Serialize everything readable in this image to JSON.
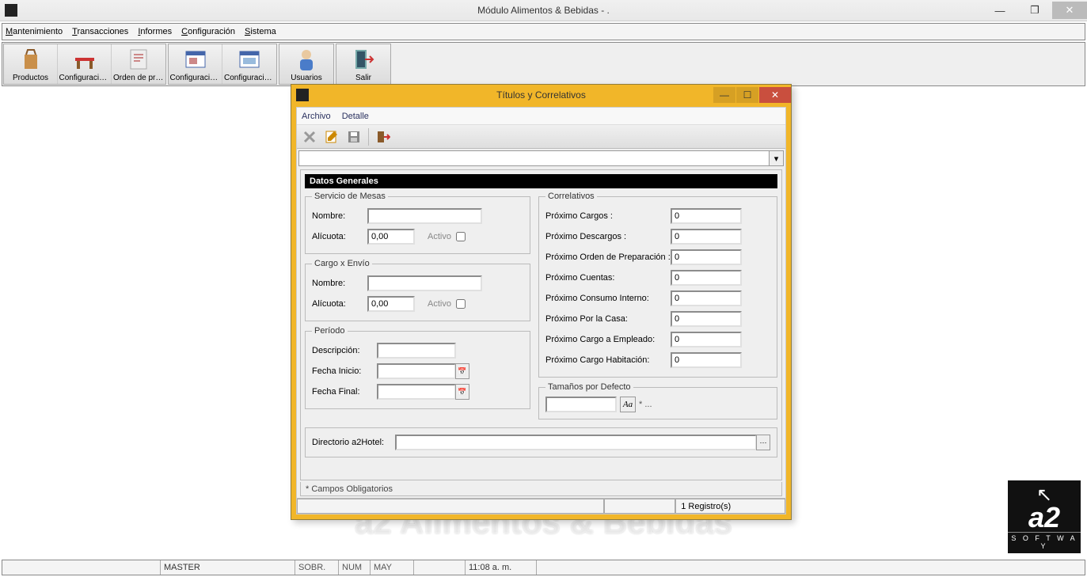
{
  "main": {
    "title": "Módulo Alimentos & Bebidas - .",
    "menu": [
      "Mantenimiento",
      "Transacciones",
      "Informes",
      "Configuración",
      "Sistema"
    ],
    "toolbar": [
      {
        "label": "Productos"
      },
      {
        "label": "Configuración d..."
      },
      {
        "label": "Orden de prepar..."
      },
      {
        "label": "Configuración d..."
      },
      {
        "label": "Configuración d..."
      },
      {
        "label": "Usuarios"
      },
      {
        "label": "Salir"
      }
    ],
    "watermark": "a2 Alimentos & Bebidas",
    "logo": {
      "cursor": "↖",
      "brand": "a2",
      "sub": "S O F T W A Y"
    }
  },
  "statusbar": {
    "user": "MASTER",
    "sobr": "SOBR.",
    "num": "NUM",
    "may": "MAY",
    "time": "11:08 a. m."
  },
  "modal": {
    "title": "Títulos y Correlativos",
    "menu": [
      "Archivo",
      "Detalle"
    ],
    "section_header": "Datos Generales",
    "mesas": {
      "legend": "Servicio de Mesas",
      "nombre_lbl": "Nombre:",
      "nombre_val": "",
      "alicuota_lbl": "Alícuota:",
      "alicuota_val": "0,00",
      "activo_lbl": "Activo"
    },
    "envio": {
      "legend": "Cargo x Envío",
      "nombre_lbl": "Nombre:",
      "nombre_val": "",
      "alicuota_lbl": "Alícuota:",
      "alicuota_val": "0,00",
      "activo_lbl": "Activo"
    },
    "periodo": {
      "legend": "Período",
      "desc_lbl": "Descripción:",
      "desc_val": "",
      "inicio_lbl": "Fecha Inicio:",
      "inicio_val": "",
      "final_lbl": "Fecha Final:",
      "final_val": ""
    },
    "correlativos": {
      "legend": "Correlativos",
      "items": [
        {
          "label": "Próximo Cargos :",
          "val": "0"
        },
        {
          "label": "Próximo Descargos :",
          "val": "0"
        },
        {
          "label": "Próximo Orden de Preparación :",
          "val": "0"
        },
        {
          "label": "Próximo Cuentas:",
          "val": "0"
        },
        {
          "label": "Próximo Consumo Interno:",
          "val": "0"
        },
        {
          "label": "Próximo Por la Casa:",
          "val": "0"
        },
        {
          "label": "Próximo Cargo a Empleado:",
          "val": "0"
        },
        {
          "label": "Próximo Cargo Habitación:",
          "val": "0"
        }
      ]
    },
    "tamanos": {
      "legend": "Tamaños por Defecto",
      "val": "",
      "hint": "* ...",
      "glyph": "Aa"
    },
    "directorio": {
      "lbl": "Directorio a2Hotel:",
      "val": ""
    },
    "footer_note": "* Campos Obligatorios",
    "status": {
      "registros": "1 Registro(s)"
    }
  }
}
